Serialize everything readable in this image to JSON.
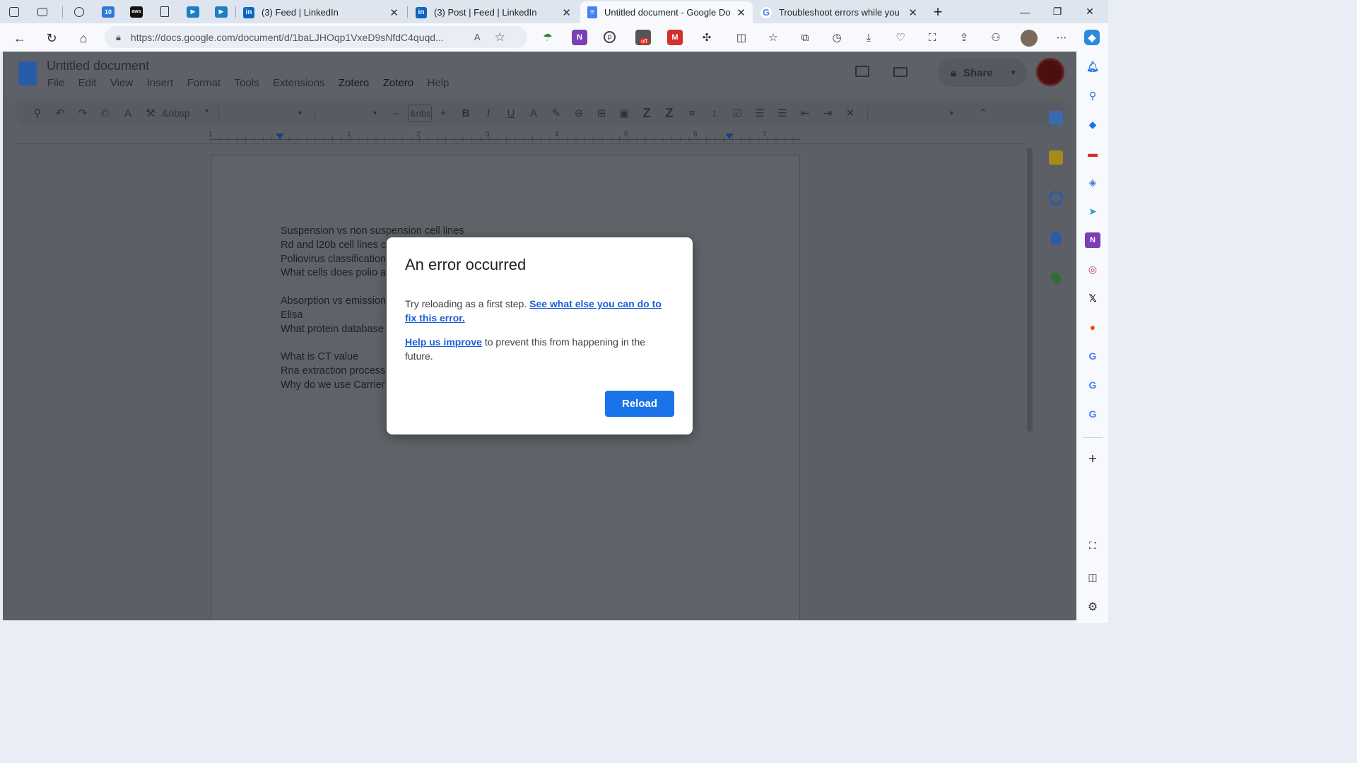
{
  "tabs": [
    {
      "title": "(3) Feed | LinkedIn",
      "icon": "linkedin-icon"
    },
    {
      "title": "(3) Post | Feed | LinkedIn",
      "icon": "linkedin-icon"
    },
    {
      "title": "Untitled document - Google Docs",
      "icon": "google-docs-icon",
      "active": true
    },
    {
      "title": "Troubleshoot errors while you ed",
      "icon": "google-icon"
    }
  ],
  "pinned_tab_icons": [
    "workspaces-icon",
    "tab-actions-icon",
    "outlook-icon",
    "calendar-icon",
    "aws-icon",
    "page-icon",
    "media-icon",
    "media-icon"
  ],
  "address": {
    "url": "https://docs.google.com/document/d/1baLJHOqp1VxeD9sNfdC4quqd..."
  },
  "extensions": {
    "counter_badge": "off"
  },
  "docs": {
    "title": "Untitled document",
    "menu": [
      "File",
      "Edit",
      "View",
      "Insert",
      "Format",
      "Tools",
      "Extensions",
      "Zotero",
      "Zotero",
      "Help"
    ],
    "share_label": "Share",
    "font_field": "&nbsp",
    "size_field": "&nbs",
    "ruler_numbers": [
      "1",
      "1",
      "2",
      "3",
      "4",
      "5",
      "6",
      "7"
    ]
  },
  "document_lines": [
    "Suspension vs non suspension cell lines",
    "Rd and l20b cell lines c",
    "Poliovirus classification",
    "What cells does polio a",
    "",
    "Absorption vs emission",
    "Elisa",
    "What protein database",
    "",
    "What is CT value",
    "Rna extraction process",
    "Why do we use Carrier"
  ],
  "dialog": {
    "title": "An error occurred",
    "line1_text": "Try reloading as a first step.",
    "line1_link": "See what else you can do to fix this error.",
    "line2_link": "Help us improve",
    "line2_text": "to prevent this from happening in the future.",
    "button": "Reload"
  },
  "colors": {
    "accent": "#1a73e8",
    "link": "#1a5fd4",
    "overlay": "#5c5f66"
  }
}
